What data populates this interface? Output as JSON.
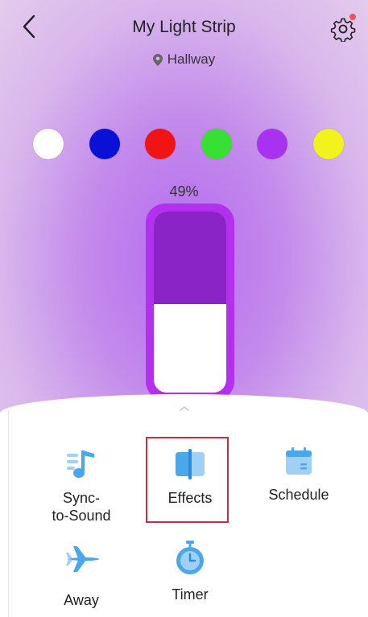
{
  "header": {
    "title": "My Light Strip",
    "location": "Hallway"
  },
  "colors": {
    "swatches": [
      "#ffffff",
      "#0a11d6",
      "#f01414",
      "#38e034",
      "#a832f0",
      "#f2f21c"
    ],
    "notification": "#f0525a",
    "slider_frame": "#b330ee",
    "slider_fill": "#8b24c6",
    "icon_blue": "#4aa8ea",
    "icon_light_blue": "#9fd0f5"
  },
  "brightness": {
    "label": "49%",
    "value": 49
  },
  "tiles": {
    "sync": {
      "label_line1": "Sync-",
      "label_line2": "to-Sound",
      "icon": "music-note-icon"
    },
    "effects": {
      "label": "Effects",
      "icon": "effects-icon"
    },
    "schedule": {
      "label": "Schedule",
      "icon": "calendar-icon"
    },
    "away": {
      "label": "Away",
      "icon": "airplane-icon"
    },
    "timer": {
      "label": "Timer",
      "icon": "stopwatch-icon"
    }
  }
}
